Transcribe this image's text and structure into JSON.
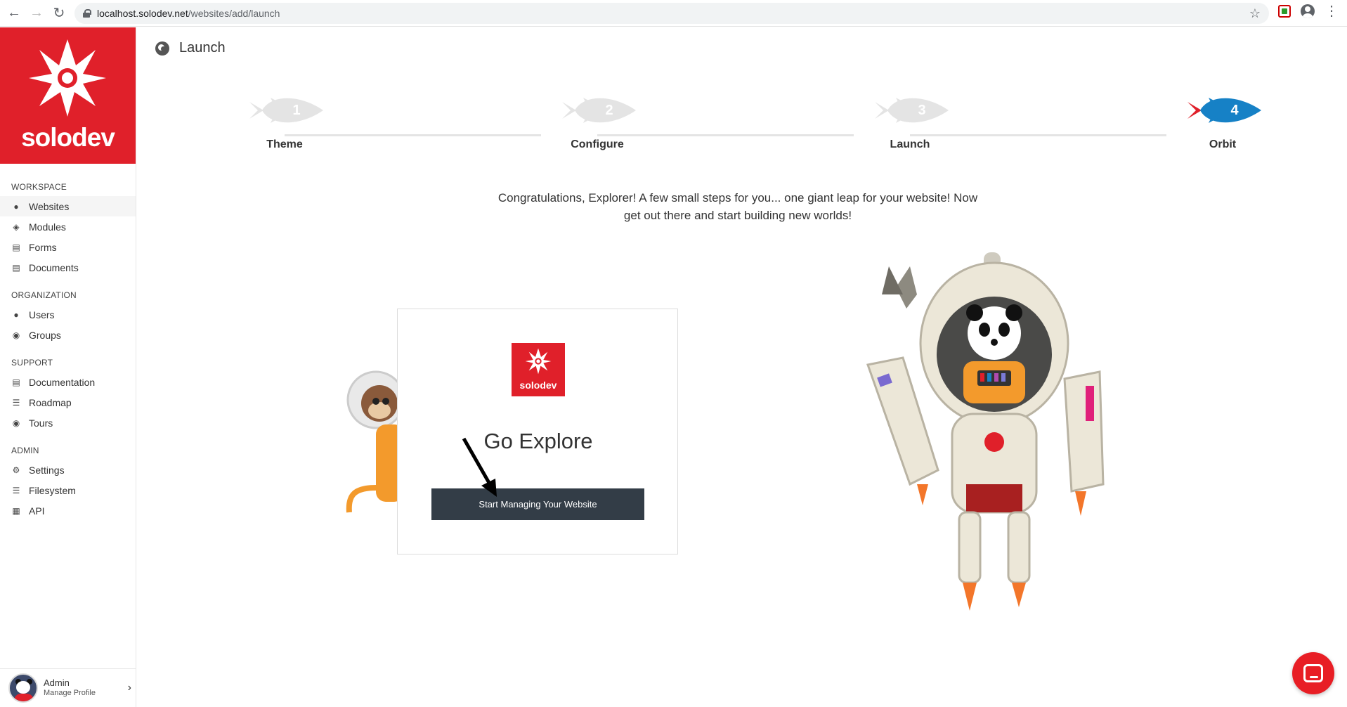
{
  "browser": {
    "url_host": "localhost.solodev.net",
    "url_path": "/websites/add/launch"
  },
  "brand": {
    "name": "solodev"
  },
  "sidebar": {
    "sections": [
      {
        "title": "WORKSPACE",
        "items": [
          {
            "label": "Websites",
            "icon": "globe-icon",
            "active": true
          },
          {
            "label": "Modules",
            "icon": "cubes-icon"
          },
          {
            "label": "Forms",
            "icon": "form-icon"
          },
          {
            "label": "Documents",
            "icon": "document-icon"
          }
        ]
      },
      {
        "title": "ORGANIZATION",
        "items": [
          {
            "label": "Users",
            "icon": "user-icon"
          },
          {
            "label": "Groups",
            "icon": "users-icon"
          }
        ]
      },
      {
        "title": "SUPPORT",
        "items": [
          {
            "label": "Documentation",
            "icon": "file-icon"
          },
          {
            "label": "Roadmap",
            "icon": "roadmap-icon"
          },
          {
            "label": "Tours",
            "icon": "compass-icon"
          }
        ]
      },
      {
        "title": "ADMIN",
        "items": [
          {
            "label": "Settings",
            "icon": "gear-icon"
          },
          {
            "label": "Filesystem",
            "icon": "list-icon"
          },
          {
            "label": "API",
            "icon": "sitemap-icon"
          }
        ]
      }
    ],
    "footer": {
      "name": "Admin",
      "subtitle": "Manage Profile"
    }
  },
  "page": {
    "title": "Launch",
    "steps": [
      {
        "number": "1",
        "label": "Theme",
        "state": "done"
      },
      {
        "number": "2",
        "label": "Configure",
        "state": "done"
      },
      {
        "number": "3",
        "label": "Launch",
        "state": "done"
      },
      {
        "number": "4",
        "label": "Orbit",
        "state": "current"
      }
    ],
    "congrats": "Congratulations, Explorer! A few small steps for you... one giant leap for your website! Now get out there and start building new worlds!",
    "card": {
      "logo_text": "solodev",
      "heading": "Go Explore",
      "button": "Start Managing Your Website"
    }
  },
  "colors": {
    "brand_red": "#e0202a",
    "step_active": "#1681c6",
    "step_inactive": "#e4e4e4",
    "button_dark": "#333d47"
  }
}
